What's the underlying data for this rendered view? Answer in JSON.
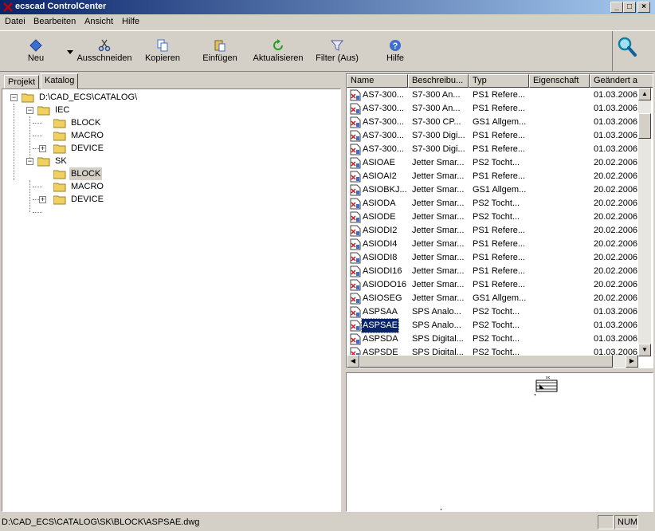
{
  "window": {
    "title": "ecscad ControlCenter",
    "min_label": "_",
    "max_label": "□",
    "close_label": "×"
  },
  "menu": [
    "Datei",
    "Bearbeiten",
    "Ansicht",
    "Hilfe"
  ],
  "toolbar": {
    "new": "Neu",
    "cut": "Ausschneiden",
    "copy": "Kopieren",
    "paste": "Einfügen",
    "refresh": "Aktualisieren",
    "filter": "Filter (Aus)",
    "help": "Hilfe"
  },
  "tabs": {
    "project": "Projekt",
    "catalog": "Katalog"
  },
  "tree": {
    "root": "D:\\CAD_ECS\\CATALOG\\",
    "iec": "IEC",
    "iec_block": "BLOCK",
    "iec_macro": "MACRO",
    "iec_device": "DEVICE",
    "sk": "SK",
    "sk_block": "BLOCK",
    "sk_macro": "MACRO",
    "sk_device": "DEVICE"
  },
  "list": {
    "columns": [
      "Name",
      "Beschreibu...",
      "Typ",
      "Eigenschaft",
      "Geändert a"
    ],
    "rows": [
      {
        "name": "AS7-300...",
        "desc": "S7-300 An...",
        "type": "PS1 Refere...",
        "prop": "",
        "date": "01.03.2006"
      },
      {
        "name": "AS7-300...",
        "desc": "S7-300 An...",
        "type": "PS1 Refere...",
        "prop": "",
        "date": "01.03.2006"
      },
      {
        "name": "AS7-300...",
        "desc": "S7-300 CP...",
        "type": "GS1 Allgem...",
        "prop": "",
        "date": "01.03.2006"
      },
      {
        "name": "AS7-300...",
        "desc": "S7-300 Digi...",
        "type": "PS1 Refere...",
        "prop": "",
        "date": "01.03.2006"
      },
      {
        "name": "AS7-300...",
        "desc": "S7-300 Digi...",
        "type": "PS1 Refere...",
        "prop": "",
        "date": "01.03.2006"
      },
      {
        "name": "ASIOAE",
        "desc": "Jetter Smar...",
        "type": "PS2 Tocht...",
        "prop": "",
        "date": "20.02.2006"
      },
      {
        "name": "ASIOAI2",
        "desc": "Jetter Smar...",
        "type": "PS1 Refere...",
        "prop": "",
        "date": "20.02.2006"
      },
      {
        "name": "ASIOBKJ...",
        "desc": "Jetter Smar...",
        "type": "GS1 Allgem...",
        "prop": "",
        "date": "20.02.2006"
      },
      {
        "name": "ASIODA",
        "desc": "Jetter Smar...",
        "type": "PS2 Tocht...",
        "prop": "",
        "date": "20.02.2006"
      },
      {
        "name": "ASIODE",
        "desc": "Jetter Smar...",
        "type": "PS2 Tocht...",
        "prop": "",
        "date": "20.02.2006"
      },
      {
        "name": "ASIODI2",
        "desc": "Jetter Smar...",
        "type": "PS1 Refere...",
        "prop": "",
        "date": "20.02.2006"
      },
      {
        "name": "ASIODI4",
        "desc": "Jetter Smar...",
        "type": "PS1 Refere...",
        "prop": "",
        "date": "20.02.2006"
      },
      {
        "name": "ASIODI8",
        "desc": "Jetter Smar...",
        "type": "PS1 Refere...",
        "prop": "",
        "date": "20.02.2006"
      },
      {
        "name": "ASIODI16",
        "desc": "Jetter Smar...",
        "type": "PS1 Refere...",
        "prop": "",
        "date": "20.02.2006"
      },
      {
        "name": "ASIODO16",
        "desc": "Jetter Smar...",
        "type": "PS1 Refere...",
        "prop": "",
        "date": "20.02.2006"
      },
      {
        "name": "ASIOSEG",
        "desc": "Jetter Smar...",
        "type": "GS1 Allgem...",
        "prop": "",
        "date": "20.02.2006"
      },
      {
        "name": "ASPSAA",
        "desc": "SPS Analo...",
        "type": "PS2 Tocht...",
        "prop": "",
        "date": "01.03.2006"
      },
      {
        "name": "ASPSAE",
        "desc": "SPS Analo...",
        "type": "PS2 Tocht...",
        "prop": "",
        "date": "01.03.2006",
        "selected": true
      },
      {
        "name": "ASPSDA",
        "desc": "SPS Digital...",
        "type": "PS2 Tocht...",
        "prop": "",
        "date": "01.03.2006"
      },
      {
        "name": "ASPSDE",
        "desc": "SPS Digital...",
        "type": "PS2 Tocht...",
        "prop": "",
        "date": "01.03.2006"
      }
    ]
  },
  "status": {
    "path": "D:\\CAD_ECS\\CATALOG\\SK\\BLOCK\\ASPSAE.dwg",
    "num": "NUM"
  },
  "colors": {
    "title_start": "#0a246a",
    "title_end": "#a6caf0",
    "selection": "#0a246a",
    "face": "#d4d0c8"
  }
}
